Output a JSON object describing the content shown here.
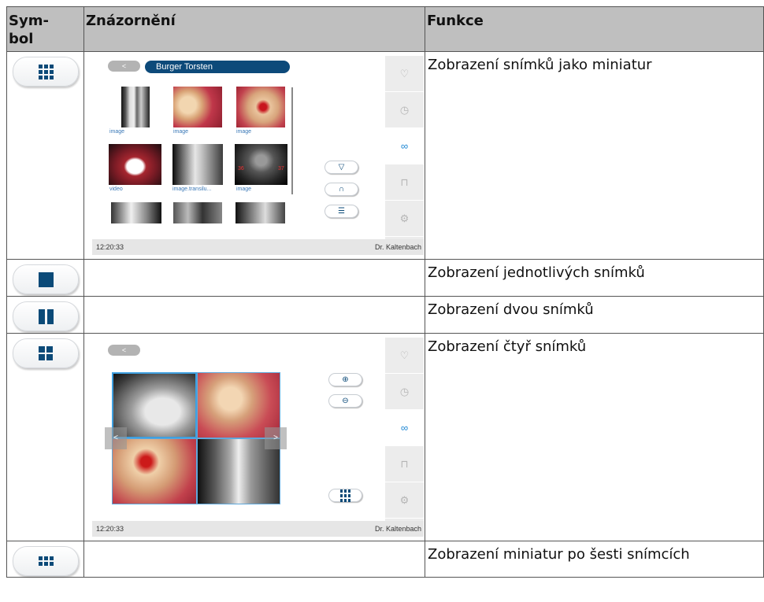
{
  "table": {
    "headers": [
      "Sym-\nbol",
      "Znázornění",
      "Funkce"
    ],
    "rows": [
      {
        "symbol_icon": "thumbnail-grid-icon",
        "function": "Zobrazení snímků jako miniatur"
      },
      {
        "symbol_icon": "single-image-icon",
        "function": "Zobrazení jednotlivých snímků"
      },
      {
        "symbol_icon": "two-images-icon",
        "function": "Zobrazení dvou snímků"
      },
      {
        "symbol_icon": "four-images-icon",
        "function": "Zobrazení čtyř snímků"
      },
      {
        "symbol_icon": "thumbnails-six-icon",
        "function": "Zobrazení miniatur po šesti snímcích"
      }
    ]
  },
  "shot1": {
    "back": "<",
    "patient": "Burger Torsten",
    "captions": [
      "image",
      "image",
      "image",
      "video",
      "image.transilu...",
      "image"
    ],
    "time": "12:20:33",
    "doctor": "Dr. Kaltenbach",
    "quad_labels": [
      "36",
      "37"
    ]
  },
  "shot2": {
    "back": "<",
    "time": "12:20:33",
    "doctor": "Dr. Kaltenbach",
    "arrow_left": "<",
    "arrow_right": ">"
  },
  "colors": {
    "accent": "#0b4a78",
    "header_bg": "#bfbfbf",
    "active_tab": "#1c86d3"
  }
}
